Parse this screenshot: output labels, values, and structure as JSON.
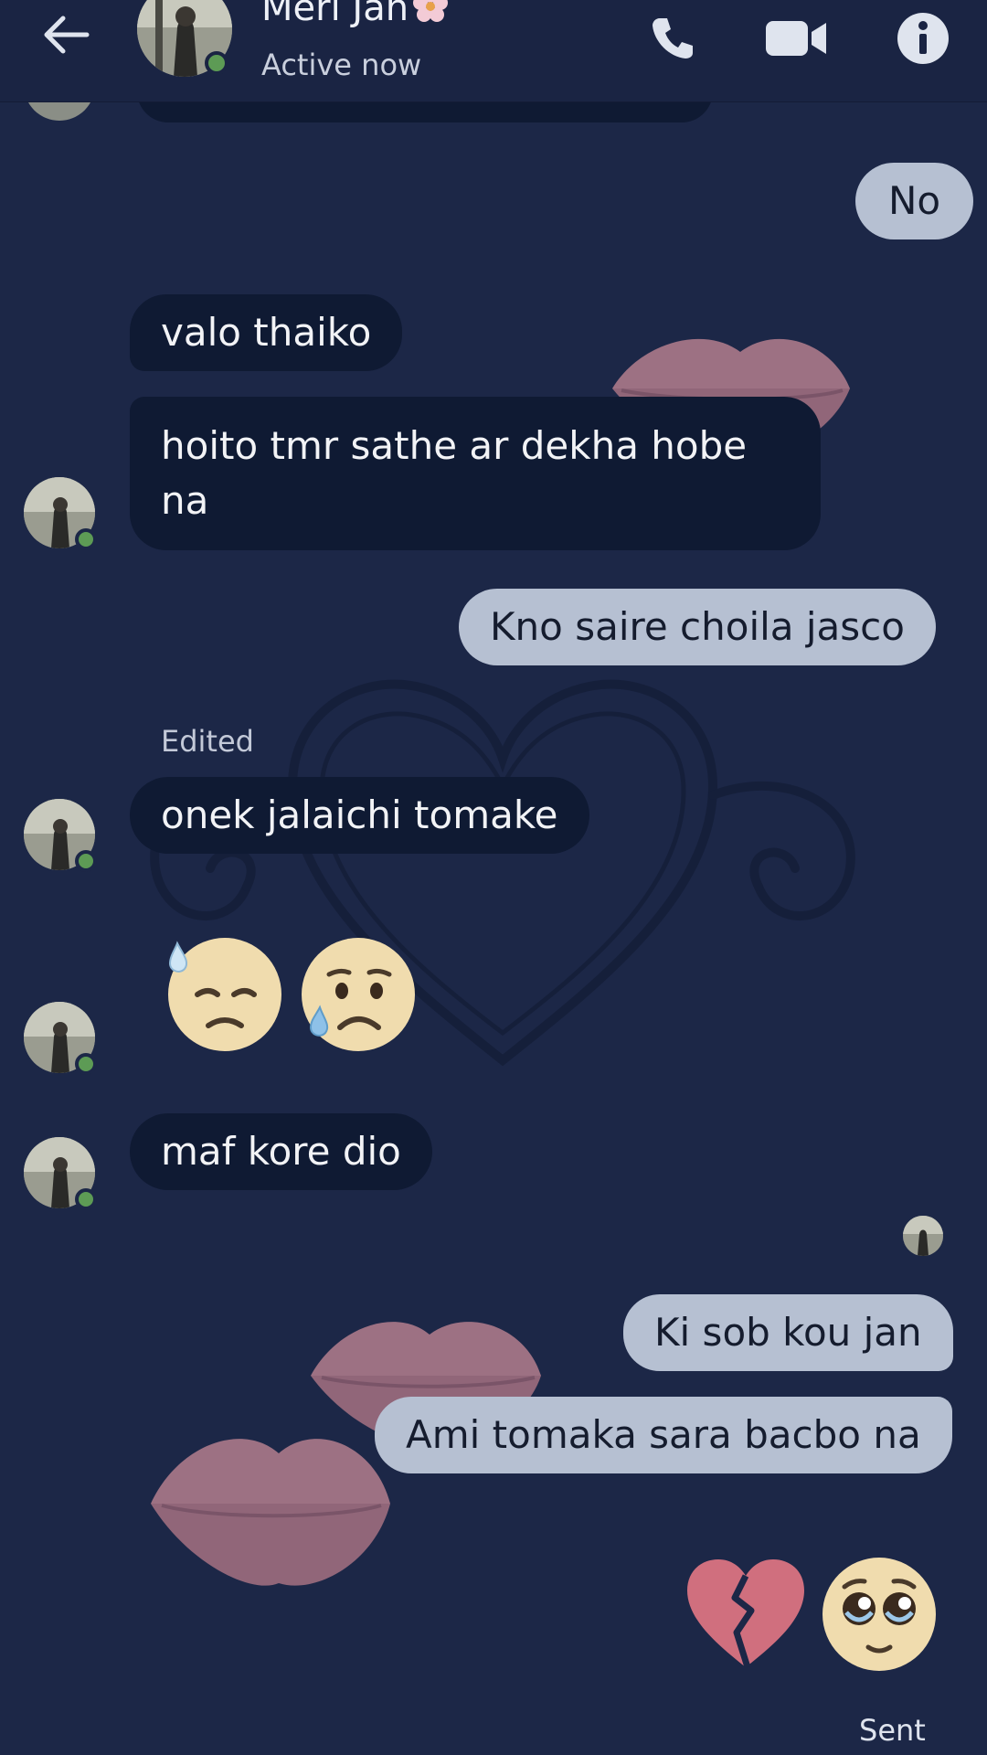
{
  "contact": {
    "name": "Meri Jan",
    "status": "Active now"
  },
  "header_icons": [
    "back-arrow-icon",
    "phone-icon",
    "video-camera-icon",
    "info-icon"
  ],
  "messages": [
    {
      "from": "me",
      "text": "No"
    },
    {
      "from": "them",
      "text": "valo thaiko"
    },
    {
      "from": "them",
      "text_line1": "hoito tmr sathe ar dekha hobe",
      "text_line2": "na"
    },
    {
      "from": "me",
      "text": "Kno saire choila jasco"
    },
    {
      "from": "them",
      "label": "Edited",
      "text": "onek jalaichi tomake"
    },
    {
      "from": "them",
      "emojis": [
        "downcast-face-with-sweat",
        "crying-face"
      ]
    },
    {
      "from": "them",
      "text": "maf kore dio"
    },
    {
      "from": "me",
      "text": "Ki sob kou jan"
    },
    {
      "from": "me",
      "text": "Ami tomaka sara bacbo na"
    },
    {
      "from": "me",
      "emojis": [
        "broken-heart",
        "pleading-face"
      ]
    }
  ],
  "footer": {
    "sent_label": "Sent"
  },
  "colors": {
    "background": "#1c2747",
    "received_bubble": "#0f1a33",
    "sent_bubble": "#b6c0d2",
    "online_dot": "#5d9b55"
  }
}
